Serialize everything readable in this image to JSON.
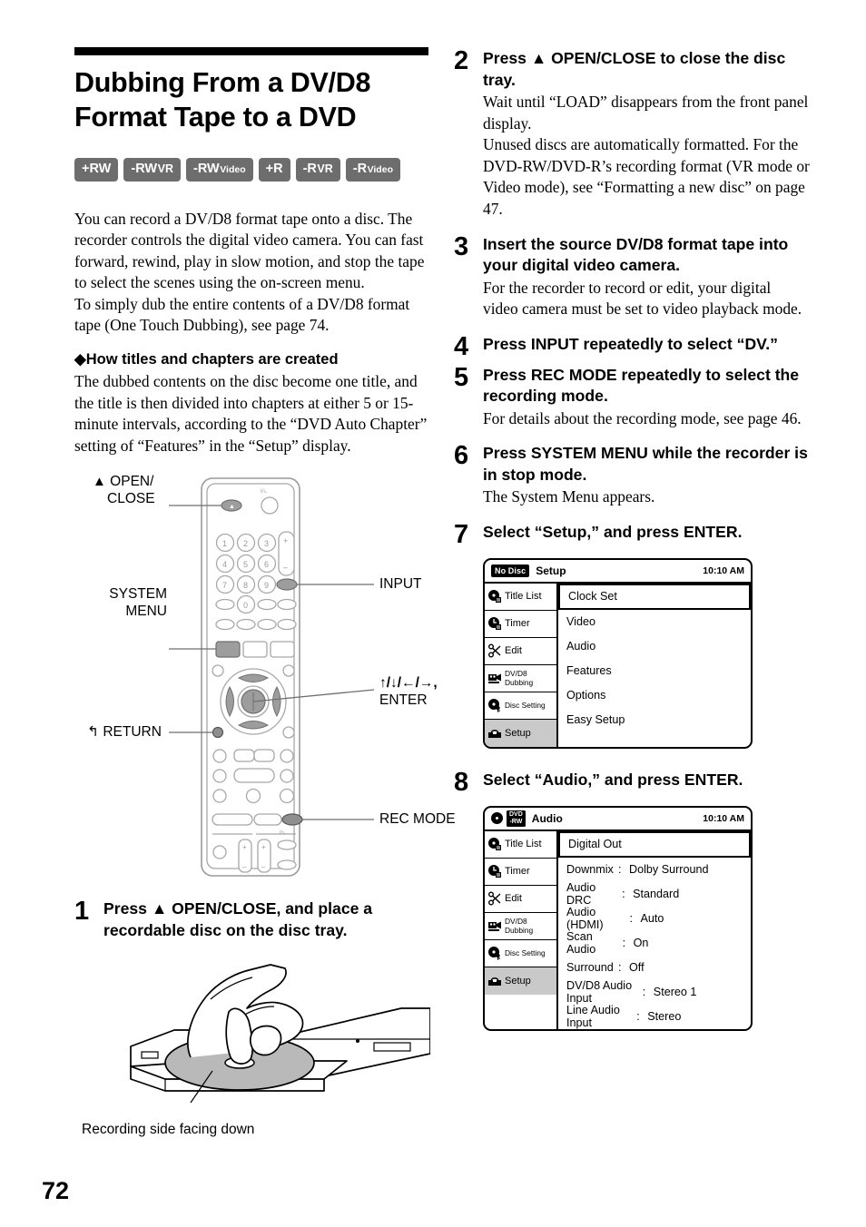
{
  "page": {
    "number": "72"
  },
  "heading": {
    "title": "Dubbing From a DV/D8 Format Tape to a DVD"
  },
  "badges": [
    {
      "main": "+RW",
      "sub": "",
      "sub_style": "none"
    },
    {
      "main": "-RW",
      "sub": "VR",
      "sub_style": "caps"
    },
    {
      "main": "-RW",
      "sub": "Video",
      "sub_style": "mixed"
    },
    {
      "main": "+R",
      "sub": "",
      "sub_style": "none"
    },
    {
      "main": "-R",
      "sub": "VR",
      "sub_style": "caps"
    },
    {
      "main": "-R",
      "sub": "Video",
      "sub_style": "mixed"
    }
  ],
  "intro": {
    "para1": "You can record a DV/D8 format tape onto a disc. The recorder controls the digital video camera. You can fast forward, rewind, play in slow motion, and stop the tape to select the scenes using the on-screen menu.",
    "para2": "To simply dub the entire contents of a DV/D8 format tape (One Touch Dubbing), see page 74."
  },
  "subsection": {
    "heading": "How titles and chapters are created",
    "body": "The dubbed contents on the disc become one title, and the title is then divided into chapters at either 5 or 15-minute intervals, according to the “DVD Auto Chapter” setting of “Features” in the “Setup” display."
  },
  "remote_callouts": {
    "open_close_l1": "OPEN/",
    "open_close_l2": "CLOSE",
    "system_menu_l1": "SYSTEM",
    "system_menu_l2": "MENU",
    "return": "RETURN",
    "input": "INPUT",
    "enter_l1": "↑/↓/←/→,",
    "enter_l2": "ENTER",
    "rec_mode": "REC MODE"
  },
  "tray_figure": {
    "caption": "Recording side facing down"
  },
  "steps": [
    {
      "num": "1",
      "title": "Press ▲ OPEN/CLOSE, and place a recordable disc on the disc tray.",
      "desc": []
    },
    {
      "num": "2",
      "title": "Press ▲ OPEN/CLOSE to close the disc tray.",
      "desc": [
        "Wait until “LOAD” disappears from the front panel display.",
        "Unused discs are automatically formatted. For the DVD-RW/DVD-R’s recording format (VR mode or Video mode), see “Formatting a new disc” on page 47."
      ]
    },
    {
      "num": "3",
      "title": "Insert the source DV/D8 format tape into your digital video camera.",
      "desc": [
        "For the recorder to record or edit, your digital video camera must be set to video playback mode."
      ]
    },
    {
      "num": "4",
      "title": "Press INPUT repeatedly to select “DV.”",
      "desc": []
    },
    {
      "num": "5",
      "title": "Press REC MODE repeatedly to select the recording mode.",
      "desc": [
        "For details about the recording mode, see page 46."
      ]
    },
    {
      "num": "6",
      "title": "Press SYSTEM MENU while the recorder is in stop mode.",
      "desc": [
        "The System Menu appears."
      ]
    },
    {
      "num": "7",
      "title": "Select “Setup,” and press ENTER.",
      "desc": []
    },
    {
      "num": "8",
      "title": "Select “Audio,” and press ENTER.",
      "desc": []
    }
  ],
  "osd_setup": {
    "disc_tag": "No Disc",
    "title": "Setup",
    "clock": "10:10 AM",
    "sidebar": [
      {
        "label": "Title List",
        "icon": "disc-title-icon",
        "active": false,
        "small": false
      },
      {
        "label": "Timer",
        "icon": "clock-timer-icon",
        "active": false,
        "small": false
      },
      {
        "label": "Edit",
        "icon": "scissors-icon",
        "active": false,
        "small": false
      },
      {
        "label": "DV/D8 Dubbing",
        "icon": "camcorder-icon",
        "active": false,
        "small": true
      },
      {
        "label": "Disc Setting",
        "icon": "disc-key-icon",
        "active": false,
        "small": true
      },
      {
        "label": "Setup",
        "icon": "toolbox-icon",
        "active": true,
        "small": false
      }
    ],
    "items": [
      {
        "label": "Clock Set",
        "value": "",
        "selected": true
      },
      {
        "label": "Video",
        "value": "",
        "selected": false
      },
      {
        "label": "Audio",
        "value": "",
        "selected": false
      },
      {
        "label": "Features",
        "value": "",
        "selected": false
      },
      {
        "label": "Options",
        "value": "",
        "selected": false
      },
      {
        "label": "Easy Setup",
        "value": "",
        "selected": false
      }
    ]
  },
  "osd_audio": {
    "disc_tag_line1": "DVD",
    "disc_tag_line2": "-RW",
    "title": "Audio",
    "clock": "10:10 AM",
    "sidebar": [
      {
        "label": "Title List",
        "icon": "disc-title-icon",
        "active": false,
        "small": false
      },
      {
        "label": "Timer",
        "icon": "clock-timer-icon",
        "active": false,
        "small": false
      },
      {
        "label": "Edit",
        "icon": "scissors-icon",
        "active": false,
        "small": false
      },
      {
        "label": "DV/D8 Dubbing",
        "icon": "camcorder-icon",
        "active": false,
        "small": true
      },
      {
        "label": "Disc Setting",
        "icon": "disc-key-icon",
        "active": false,
        "small": true
      },
      {
        "label": "Setup",
        "icon": "toolbox-icon",
        "active": true,
        "small": false
      }
    ],
    "items": [
      {
        "label": "Digital Out",
        "colon": "",
        "value": "",
        "selected": true
      },
      {
        "label": "Downmix",
        "colon": ":",
        "value": "Dolby Surround",
        "selected": false
      },
      {
        "label": "Audio DRC",
        "colon": ":",
        "value": "Standard",
        "selected": false
      },
      {
        "label": "Audio (HDMI)",
        "colon": ":",
        "value": "Auto",
        "selected": false
      },
      {
        "label": "Scan Audio",
        "colon": ":",
        "value": "On",
        "selected": false
      },
      {
        "label": "Surround",
        "colon": ":",
        "value": "Off",
        "selected": false
      },
      {
        "label": "DV/D8 Audio Input",
        "colon": ":",
        "value": "Stereo 1",
        "selected": false
      },
      {
        "label": "Line Audio Input",
        "colon": ":",
        "value": "Stereo",
        "selected": false
      }
    ]
  },
  "colors": {
    "badge_gray": "#6d6d6d",
    "osd_active": "#c9c9c9",
    "remote_outline": "#9a9a9a",
    "remote_button_gray": "#9d9d9d"
  }
}
